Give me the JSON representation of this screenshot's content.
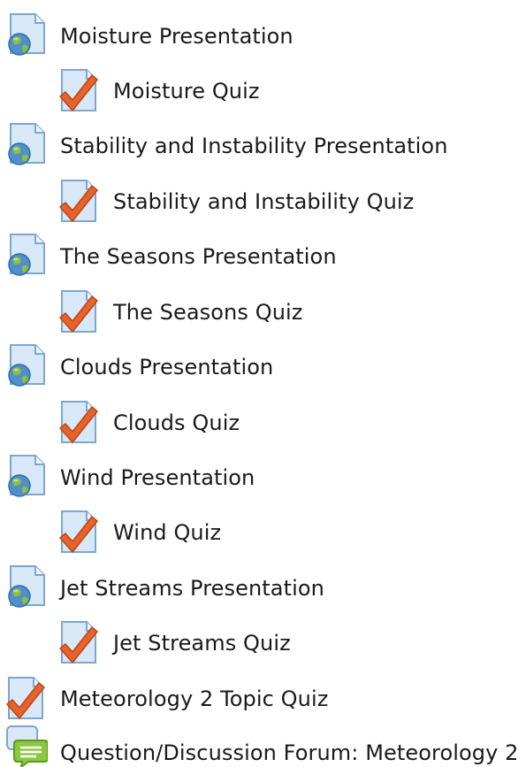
{
  "activities": [
    {
      "label": "Moisture Presentation",
      "type": "presentation",
      "icon": "globe-document-icon"
    },
    {
      "label": "Moisture Quiz",
      "type": "quiz",
      "icon": "quiz-check-icon"
    },
    {
      "label": "Stability and Instability Presentation",
      "type": "presentation",
      "icon": "globe-document-icon"
    },
    {
      "label": "Stability and Instability Quiz",
      "type": "quiz",
      "icon": "quiz-check-icon"
    },
    {
      "label": "The Seasons Presentation",
      "type": "presentation",
      "icon": "globe-document-icon"
    },
    {
      "label": "The Seasons Quiz",
      "type": "quiz",
      "icon": "quiz-check-icon"
    },
    {
      "label": "Clouds Presentation",
      "type": "presentation",
      "icon": "globe-document-icon"
    },
    {
      "label": "Clouds Quiz",
      "type": "quiz",
      "icon": "quiz-check-icon"
    },
    {
      "label": "Wind Presentation",
      "type": "presentation",
      "icon": "globe-document-icon"
    },
    {
      "label": "Wind Quiz",
      "type": "quiz",
      "icon": "quiz-check-icon"
    },
    {
      "label": "Jet Streams Presentation",
      "type": "presentation",
      "icon": "globe-document-icon"
    },
    {
      "label": "Jet Streams Quiz",
      "type": "quiz",
      "icon": "quiz-check-icon"
    },
    {
      "label": "Meteorology 2 Topic Quiz",
      "type": "quiz",
      "icon": "quiz-check-icon"
    },
    {
      "label": "Question/Discussion Forum: Meteorology 2",
      "type": "forum",
      "icon": "forum-speech-icon"
    }
  ],
  "colors": {
    "text": "#1a1a1a",
    "doc_blue": "#c9def3",
    "doc_border": "#7ea6d0",
    "globe_blue": "#4f8fce",
    "globe_green": "#8fbf3a",
    "check_orange": "#e8632a",
    "forum_green": "#8dc63f"
  }
}
